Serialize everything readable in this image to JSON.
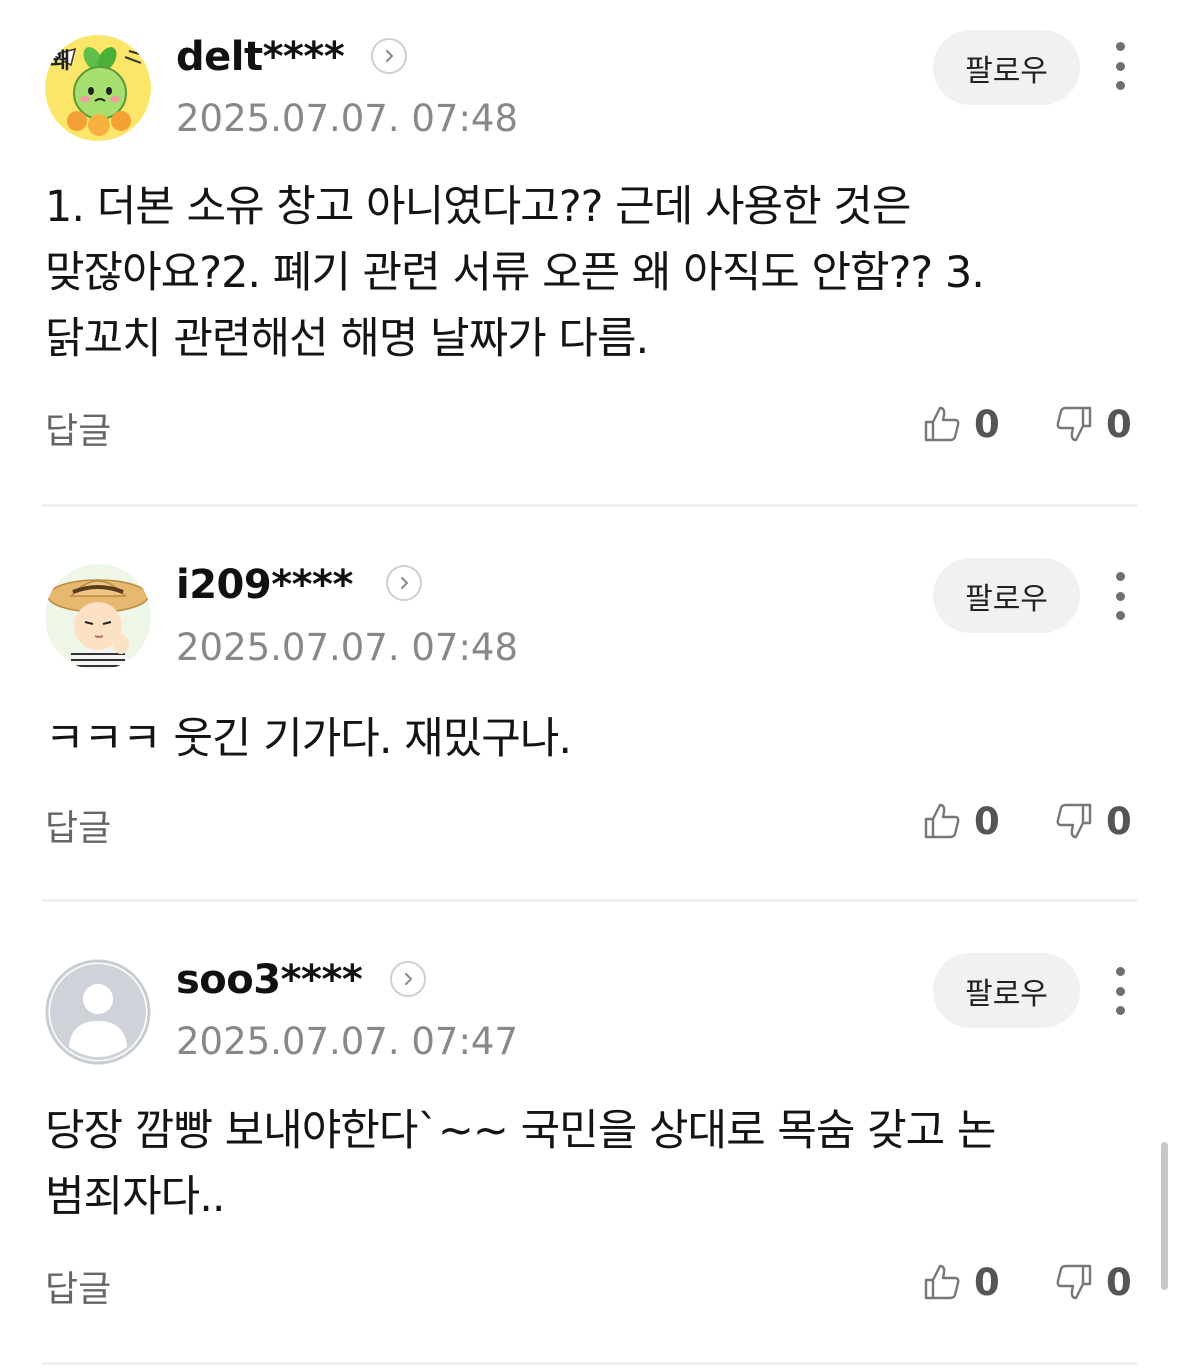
{
  "comments": [
    {
      "username": "delt****",
      "timestamp": "2025.07.07. 07:48",
      "follow_label": "팔로우",
      "text": "1. 더본 소유 창고 아니였다고?? 근데 사용한 것은 맞잖아요?2. 폐기 관련 서류 오픈 왜 아직도 안함?? 3. 닭꼬치 관련해선 해명 날짜가 다름.",
      "reply_label": "답글",
      "likes": "0",
      "dislikes": "0",
      "avatar_icon": "sprout-character-avatar",
      "avatar_badge_text": "왜"
    },
    {
      "username": "i209****",
      "timestamp": "2025.07.07. 07:48",
      "follow_label": "팔로우",
      "text": "ㅋㅋㅋ 웃긴 기가다. 재밌구나.",
      "reply_label": "답글",
      "likes": "0",
      "dislikes": "0",
      "avatar_icon": "straw-hat-character-avatar"
    },
    {
      "username": "soo3****",
      "timestamp": "2025.07.07. 07:47",
      "follow_label": "팔로우",
      "text": "당장 깜빵 보내야한다`~~ 국민을 상대로 목숨 갖고 논 범죄자다..",
      "reply_label": "답글",
      "likes": "0",
      "dislikes": "0",
      "avatar_icon": "default-user-avatar"
    }
  ],
  "colors": {
    "username": "#111111",
    "timestamp": "#888888",
    "follow_bg": "#f1f1f1",
    "divider": "#efefef",
    "vote_icon": "#777777"
  }
}
